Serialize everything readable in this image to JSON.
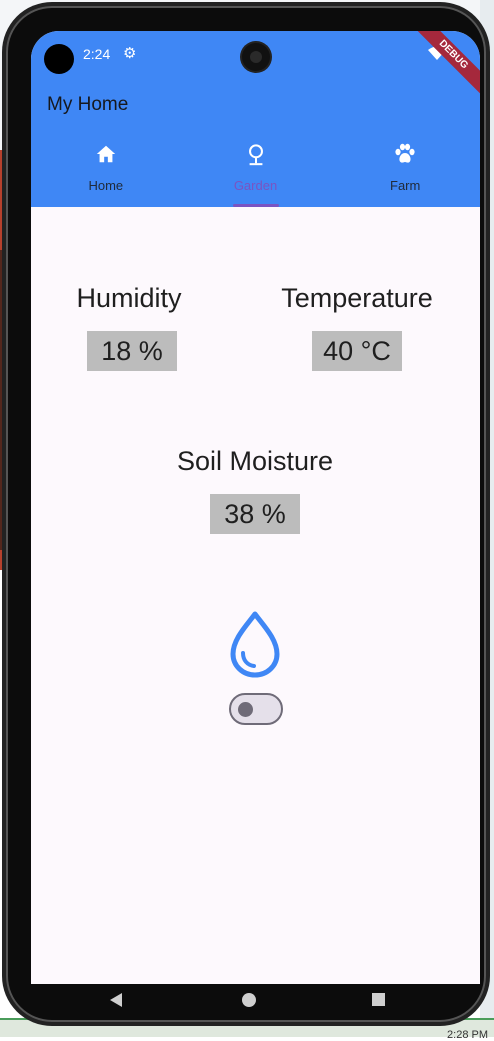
{
  "status_bar": {
    "time": "2:24",
    "settings_icon": "gear-icon",
    "wifi_icon": "wifi-icon",
    "debug_banner": "DEBUG"
  },
  "app": {
    "title": "My Home",
    "accent_color": "#3f87f5",
    "selected_color": "#7a54c2"
  },
  "tabs": [
    {
      "label": "Home",
      "icon": "home-icon",
      "selected": false
    },
    {
      "label": "Garden",
      "icon": "garden-icon",
      "selected": true
    },
    {
      "label": "Farm",
      "icon": "paw-icon",
      "selected": false
    }
  ],
  "metrics": {
    "humidity": {
      "label": "Humidity",
      "value": "18 %"
    },
    "temperature": {
      "label": "Temperature",
      "value": "40 °C"
    },
    "soil_moisture": {
      "label": "Soil Moisture",
      "value": "38 %"
    }
  },
  "irrigation": {
    "icon": "water-drop-icon",
    "toggle_on": false
  },
  "nav": {
    "back": "back-icon",
    "home": "home-circle-icon",
    "recent": "recent-apps-icon"
  },
  "desktop": {
    "clock": "2:28 PM"
  }
}
